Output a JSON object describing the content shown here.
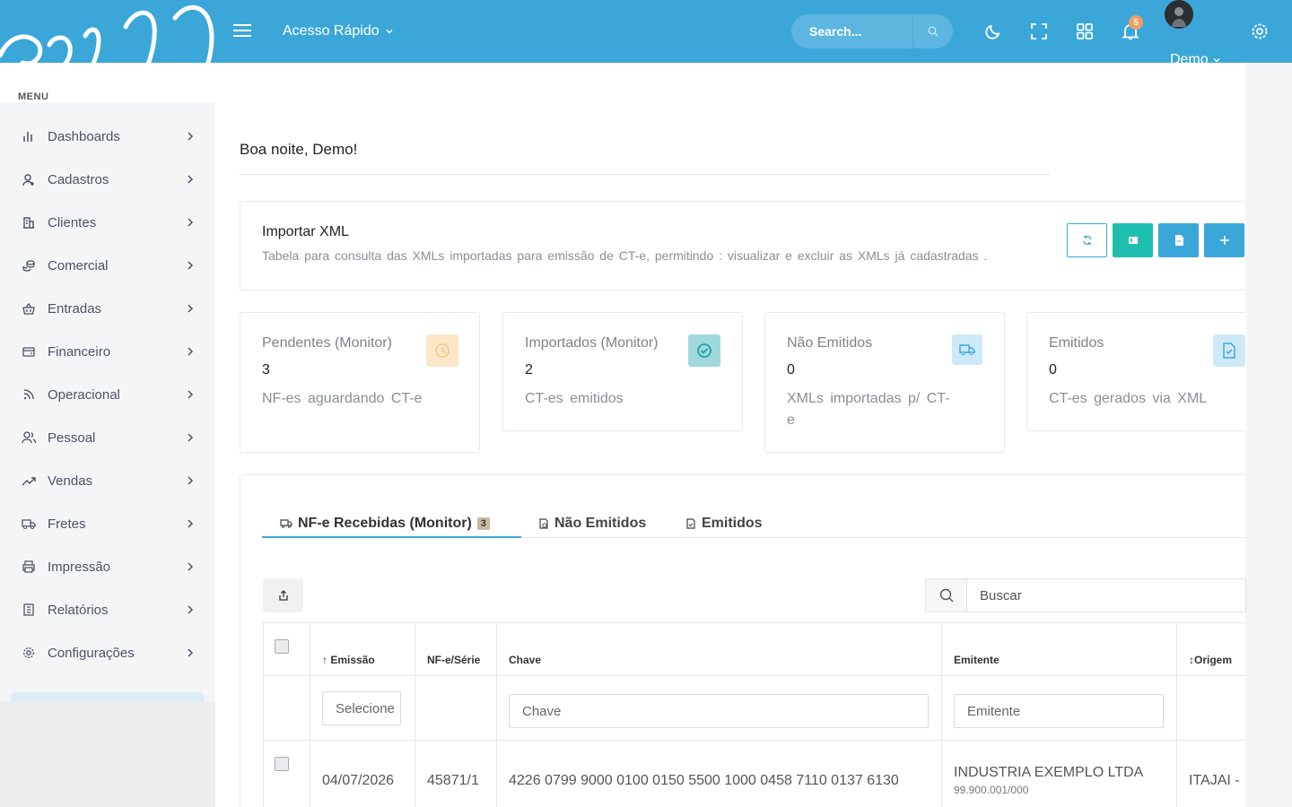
{
  "topbar": {
    "quick_access": "Acesso Rápido",
    "search_placeholder": "Search...",
    "notification_count": "5",
    "user_name": "Demo",
    "accent": "#3ba7d8"
  },
  "sidebar": {
    "menu_label": "MENU",
    "items": [
      {
        "label": "Dashboards",
        "icon": "bar-chart-icon"
      },
      {
        "label": "Cadastros",
        "icon": "user-plus-icon"
      },
      {
        "label": "Clientes",
        "icon": "building-icon"
      },
      {
        "label": "Comercial",
        "icon": "coins-icon"
      },
      {
        "label": "Entradas",
        "icon": "basket-icon"
      },
      {
        "label": "Financeiro",
        "icon": "wallet-icon"
      },
      {
        "label": "Operacional",
        "icon": "rss-icon"
      },
      {
        "label": "Pessoal",
        "icon": "users-icon"
      },
      {
        "label": "Vendas",
        "icon": "trending-up-icon"
      },
      {
        "label": "Fretes",
        "icon": "truck-icon"
      },
      {
        "label": "Impressão",
        "icon": "printer-icon"
      },
      {
        "label": "Relatórios",
        "icon": "file-text-icon"
      },
      {
        "label": "Configurações",
        "icon": "gear-icon"
      }
    ]
  },
  "main": {
    "greeting": "Boa noite, Demo!",
    "import": {
      "title": "Importar XML",
      "description": "Tabela para consulta das XMLs importadas para emissão de CT-e, permitindo : visualizar e excluir as XMLs já cadastradas ."
    },
    "stats": [
      {
        "title": "Pendentes (Monitor)",
        "value": "3",
        "desc": "NF-es aguardando CT-e",
        "icon": "clock-icon",
        "color": "#fbe7c8",
        "icon_color": "#f3c58a"
      },
      {
        "title": "Importados (Monitor)",
        "value": "2",
        "desc": "CT-es emitidos",
        "icon": "check-circle-icon",
        "color": "#9fd9dd",
        "icon_color": "#1a9aa3"
      },
      {
        "title": "Não Emitidos",
        "value": "0",
        "desc": "XMLs importadas p/ CT-e",
        "icon": "truck-icon",
        "color": "#cde9f7",
        "icon_color": "#3ba7d8"
      },
      {
        "title": "Emitidos",
        "value": "0",
        "desc": "CT-es gerados via XML",
        "icon": "file-check-icon",
        "color": "#cde9f7",
        "icon_color": "#3ba7d8"
      }
    ],
    "tabs": [
      {
        "label": "NF-e Recebidas (Monitor)",
        "badge": "3"
      },
      {
        "label": "Não Emitidos"
      },
      {
        "label": "Emitidos"
      }
    ],
    "table": {
      "search_placeholder": "Buscar",
      "headers": {
        "emissao": "↑ Emissão",
        "nf_serie": "NF-e/Série",
        "chave": "Chave",
        "emitente": "Emitente",
        "origem": "↕Origem"
      },
      "filters": {
        "emissao": "Selecione",
        "chave": "Chave",
        "emitente": "Emitente"
      },
      "rows": [
        {
          "emissao": "04/07/2026",
          "nf_serie": "45871/1",
          "chave": "4226 0799 9000 0100 0150 5500 1000 0458 7110 0137 6130",
          "emitente": "INDUSTRIA EXEMPLO LTDA",
          "cnpj": "99.900.001/000",
          "origem": "ITAJAI -"
        }
      ]
    }
  }
}
